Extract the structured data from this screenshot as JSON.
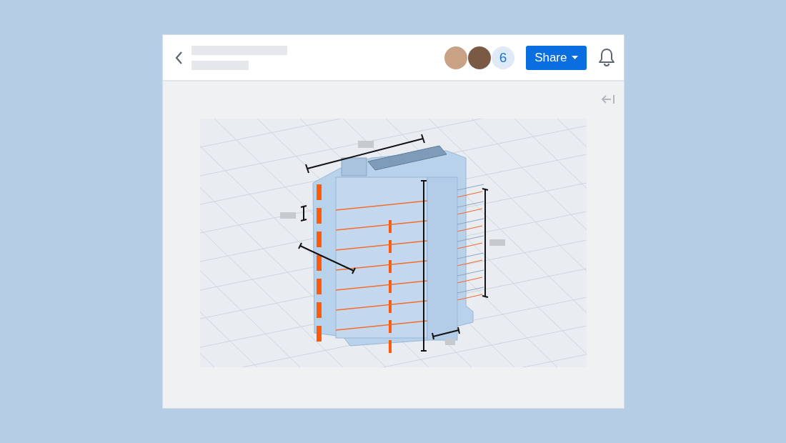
{
  "header": {
    "collaborator_count": "6",
    "share_button": "Share"
  }
}
